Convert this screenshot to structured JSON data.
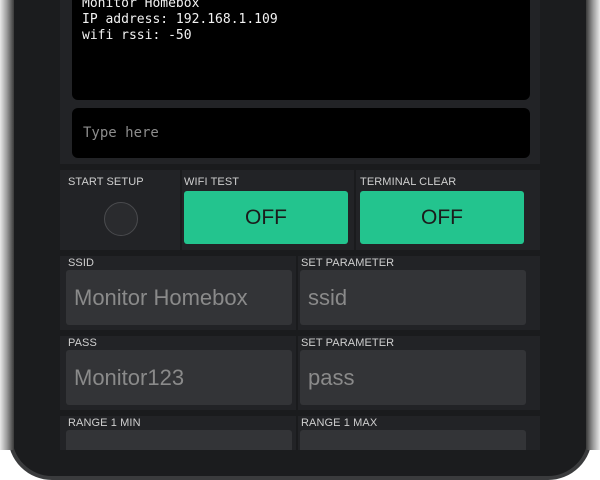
{
  "terminal": {
    "lines": [
      "Monitor Homebox",
      "IP address: 192.168.1.109",
      "wifi rssi: -50"
    ],
    "input_placeholder": "Type here"
  },
  "controls": {
    "start_setup": {
      "label": "START SETUP"
    },
    "wifi_test": {
      "label": "WIFI TEST",
      "state": "OFF"
    },
    "terminal_clear": {
      "label": "TERMINAL CLEAR",
      "state": "OFF"
    }
  },
  "settings": {
    "ssid": {
      "label": "SSID",
      "value": "Monitor Homebox"
    },
    "ssid_param": {
      "label": "SET PARAMETER",
      "value": "ssid"
    },
    "pass": {
      "label": "PASS",
      "value": "Monitor123"
    },
    "pass_param": {
      "label": "SET PARAMETER",
      "value": "pass"
    },
    "range_min": {
      "label": "RANGE 1 MIN"
    },
    "range_max": {
      "label": "RANGE 1 MAX"
    }
  },
  "colors": {
    "accent": "#23c48e",
    "background": "#222326",
    "terminal": "#000000"
  }
}
